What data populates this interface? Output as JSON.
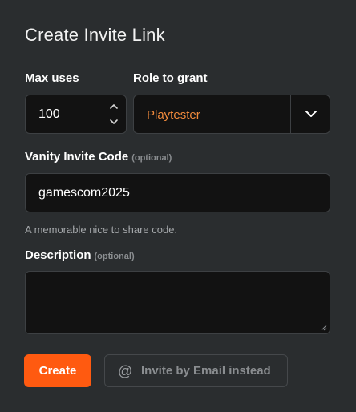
{
  "dialog": {
    "title": "Create Invite Link"
  },
  "max_uses": {
    "label": "Max uses",
    "value": "100"
  },
  "role": {
    "label": "Role to grant",
    "selected": "Playtester",
    "selected_color": "#f08a3c"
  },
  "vanity": {
    "label": "Vanity Invite Code",
    "optional": "(optional)",
    "value": "gamescom2025",
    "hint": "A memorable nice to share code."
  },
  "description": {
    "label": "Description",
    "optional": "(optional)",
    "value": ""
  },
  "actions": {
    "create_label": "Create",
    "create_color": "#ff5a10",
    "email_label": "Invite by Email instead",
    "email_icon": "at-icon"
  }
}
